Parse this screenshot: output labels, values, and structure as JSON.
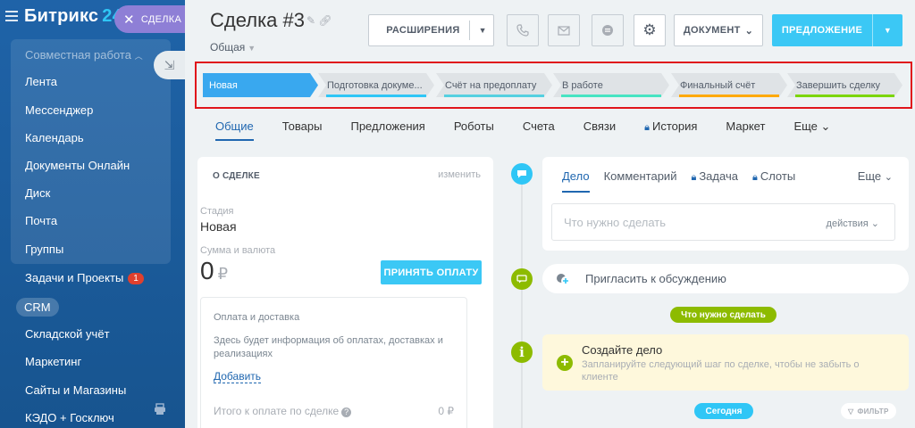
{
  "sidebar": {
    "brand": "Битрикс",
    "brand_suffix": "24",
    "group_title": "Совместная работа",
    "group_items": [
      "Лента",
      "Мессенджер",
      "Календарь",
      "Документы Онлайн",
      "Диск",
      "Почта",
      "Группы"
    ],
    "tasks_label": "Задачи и Проекты",
    "tasks_badge": "1",
    "crm_label": "CRM",
    "items_after": [
      "Складской учёт",
      "Маркетинг",
      "Сайты и Магазины",
      "КЭДО + Госключ"
    ]
  },
  "close_tab": {
    "label": "СДЕЛКА"
  },
  "header": {
    "title": "Сделка #3",
    "category": "Общая",
    "extensions_label": "РАСШИРЕНИЯ",
    "document_label": "ДОКУМЕНТ",
    "proposal_label": "ПРЕДЛОЖЕНИЕ"
  },
  "stages": [
    {
      "label": "Новая",
      "active": true,
      "color": "#39a8ef"
    },
    {
      "label": "Подготовка докуме...",
      "active": false,
      "color": "#2fc6f6"
    },
    {
      "label": "Счёт на предоплату",
      "active": false,
      "color": "#55d0e0"
    },
    {
      "label": "В работе",
      "active": false,
      "color": "#47e4c2"
    },
    {
      "label": "Финальный счёт",
      "active": false,
      "color": "#ffa900"
    },
    {
      "label": "Завершить сделку",
      "active": false,
      "color": "#7bd500"
    }
  ],
  "tabs": [
    {
      "label": "Общие",
      "active": true,
      "locked": false
    },
    {
      "label": "Товары",
      "active": false,
      "locked": false
    },
    {
      "label": "Предложения",
      "active": false,
      "locked": false
    },
    {
      "label": "Роботы",
      "active": false,
      "locked": false
    },
    {
      "label": "Счета",
      "active": false,
      "locked": false
    },
    {
      "label": "Связи",
      "active": false,
      "locked": false
    },
    {
      "label": "История",
      "active": false,
      "locked": true
    },
    {
      "label": "Маркет",
      "active": false,
      "locked": false
    },
    {
      "label": "Еще",
      "active": false,
      "locked": false,
      "dropdown": true
    }
  ],
  "about": {
    "title": "О СДЕЛКЕ",
    "edit": "изменить",
    "stage_label": "Стадия",
    "stage_value": "Новая",
    "amount_label": "Сумма и валюта",
    "amount_value": "0",
    "currency": "₽",
    "accept_label": "ПРИНЯТЬ ОПЛАТУ",
    "payment": {
      "title": "Оплата и доставка",
      "text": "Здесь будет информация об оплатах, доставках и реализациях",
      "add": "Добавить",
      "total_label": "Итого к оплате по сделке",
      "total_value": "0 ₽"
    }
  },
  "editor": {
    "tabs": [
      "Дело",
      "Комментарий",
      "Задача",
      "Слоты"
    ],
    "more": "Еще",
    "placeholder": "Что нужно сделать",
    "actions": "действия"
  },
  "invite": {
    "text": "Пригласить к обсуждению"
  },
  "todo_pill": "Что нужно сделать",
  "todo": {
    "title": "Создайте дело",
    "text": "Запланируйте следующий шаг по сделке, чтобы не забыть о клиенте"
  },
  "today_pill": "Сегодня",
  "filter_label": "ФИЛЬТР",
  "colors": {
    "sidebar": "#1f63a8",
    "accent": "#3bc8f5",
    "link": "#2067b0",
    "green": "#8dbb00",
    "purple": "#8e7fd6"
  }
}
